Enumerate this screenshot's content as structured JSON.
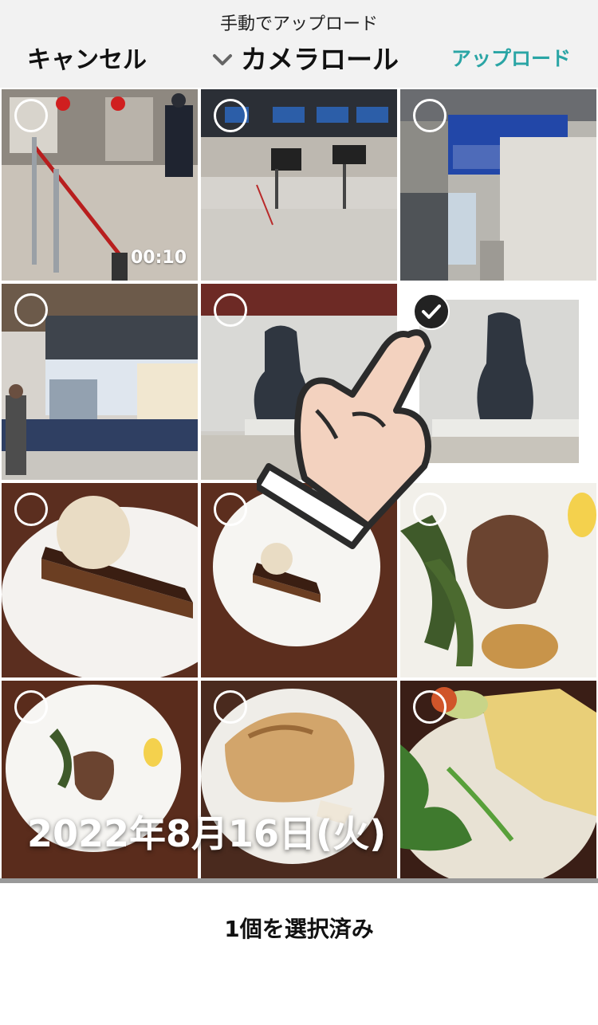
{
  "header": {
    "subtitle": "手動でアップロード",
    "cancel_label": "キャンセル",
    "album_label": "カメラロール",
    "upload_label": "アップロード",
    "album_icon": "chevron-down-icon"
  },
  "grid": {
    "items": [
      {
        "kind": "video",
        "duration": "00:10",
        "selected": false
      },
      {
        "kind": "photo",
        "selected": false
      },
      {
        "kind": "photo",
        "selected": false
      },
      {
        "kind": "photo",
        "selected": false
      },
      {
        "kind": "photo",
        "selected": false
      },
      {
        "kind": "photo",
        "selected": true
      },
      {
        "kind": "photo",
        "selected": false
      },
      {
        "kind": "photo",
        "selected": false
      },
      {
        "kind": "photo",
        "selected": false
      },
      {
        "kind": "photo",
        "selected": false
      },
      {
        "kind": "photo",
        "selected": false
      },
      {
        "kind": "photo",
        "selected": false
      }
    ],
    "date_overlay": "2022年8月16日(火)"
  },
  "footer": {
    "status": "1個を選択済み"
  },
  "colors": {
    "accent": "#2aa5a5",
    "header_bg": "#f2f2f2"
  }
}
